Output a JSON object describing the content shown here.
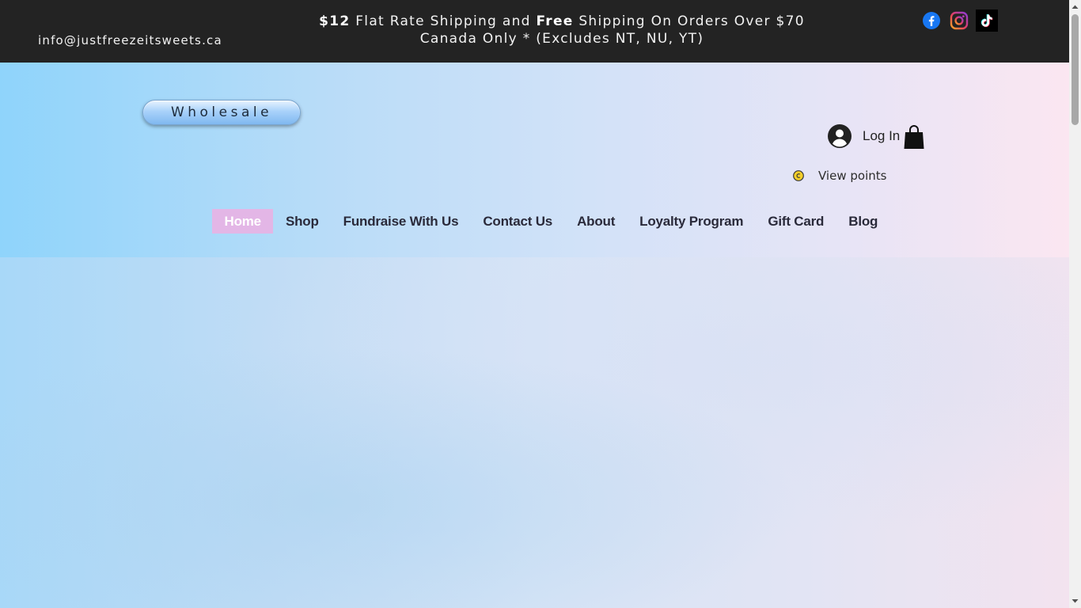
{
  "topbar": {
    "email": "info@justfreezeitsweets.ca",
    "promo": {
      "price": "$12",
      "part1": " Flat Rate Shipping and ",
      "free": "Free",
      "part2": " Shipping On Orders Over $70",
      "line2": "Canada Only * (Excludes NT, NU, YT)"
    },
    "socials": [
      "facebook-icon",
      "instagram-icon",
      "tiktok-icon"
    ]
  },
  "header": {
    "wholesale_label": "Wholesale",
    "login_label": "Log In",
    "points_label": "View points"
  },
  "nav": {
    "items": [
      {
        "label": "Home",
        "active": true
      },
      {
        "label": "Shop"
      },
      {
        "label": "Fundraise With Us"
      },
      {
        "label": "Contact Us"
      },
      {
        "label": "About"
      },
      {
        "label": "Loyalty Program"
      },
      {
        "label": "Gift Card"
      },
      {
        "label": "Blog"
      }
    ]
  },
  "colors": {
    "topbar_bg": "#232323",
    "nav_active_bg": "#e3b6e6",
    "facebook": "#1877f2"
  }
}
